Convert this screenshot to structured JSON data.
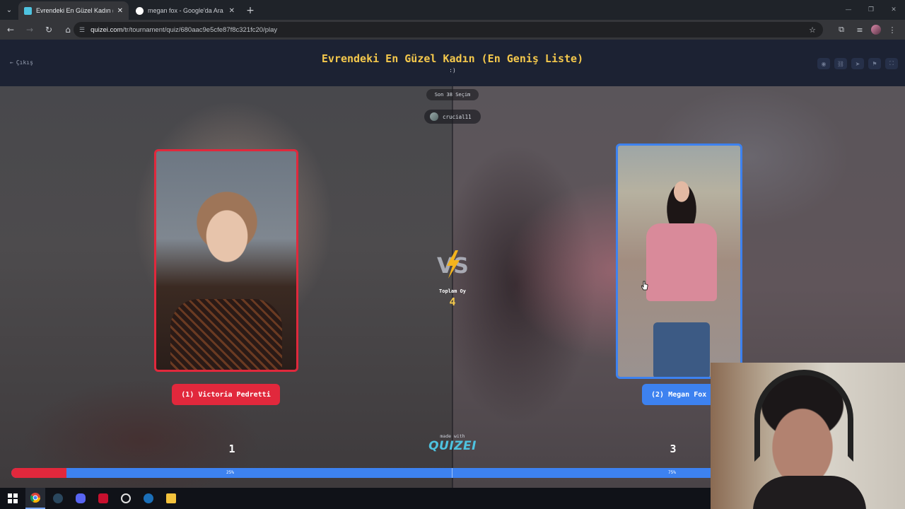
{
  "browser": {
    "tabs": [
      {
        "title": "Evrendeki En Güzel Kadın (En G",
        "active": true,
        "favicon_color": "#4ec3e0"
      },
      {
        "title": "megan fox - Google'da Ara",
        "active": false,
        "favicon_color": "#ffffff"
      }
    ],
    "new_tab": "+",
    "url_host": "quizei.com",
    "url_path": "/tr/tournament/quiz/680aac9e5cfe87f8c321fc20/play"
  },
  "header": {
    "exit_label": "Çıkış",
    "title": "Evrendeki En Güzel Kadın (En Geniş Liste)",
    "subtitle": ":)"
  },
  "arena": {
    "recent_label": "Son 38 Seçim",
    "username": "crucial11",
    "left": {
      "name": "(1) Victoria Pedretti",
      "votes": "1",
      "percent_label": "25%",
      "percent": 25,
      "color": "#e1283c"
    },
    "right": {
      "name": "(2) Megan Fox",
      "votes": "3",
      "percent_label": "75%",
      "percent": 75,
      "color": "#3d82f0"
    },
    "total_label": "Toplam Oy",
    "total_value": "4",
    "made_with": "made with",
    "logo": "QUIZEI"
  },
  "taskbar": {
    "apps": [
      "windows-start",
      "chrome",
      "steam",
      "discord",
      "app-red",
      "app-circle",
      "steam-2",
      "file-explorer"
    ]
  }
}
